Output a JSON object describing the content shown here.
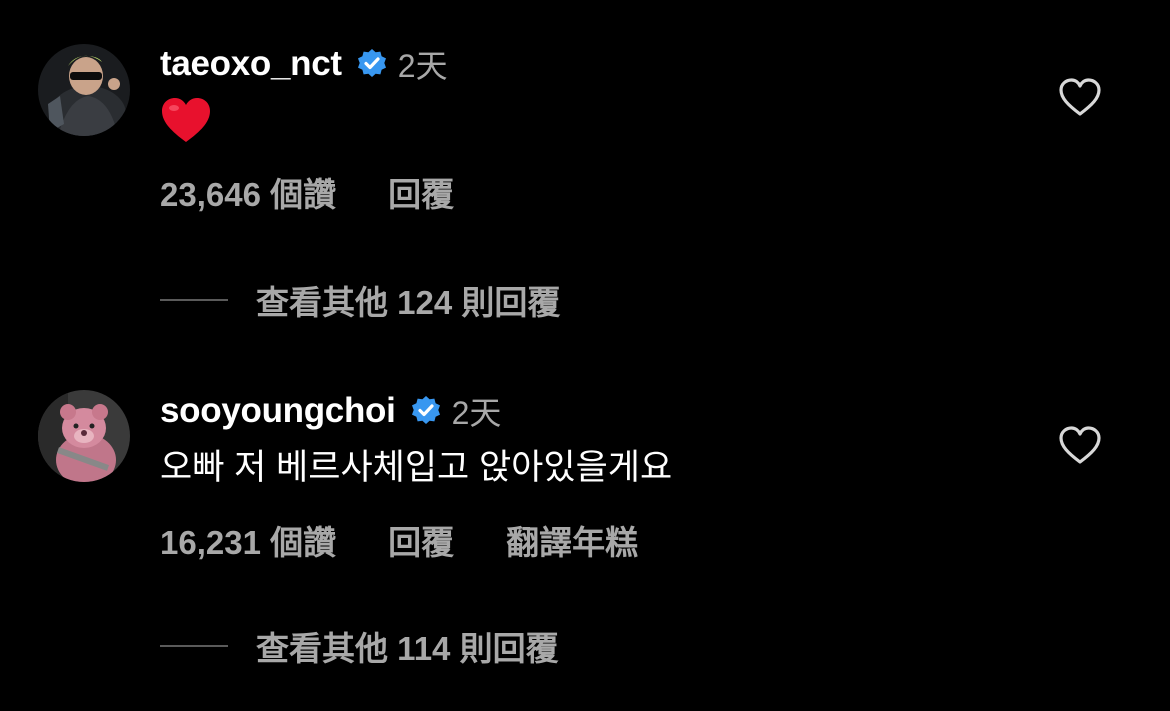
{
  "comments": [
    {
      "username": "taeoxo_nct",
      "verified": true,
      "time": "2天",
      "body": "❤️",
      "likes": "23,646 個讚",
      "reply_label": "回覆",
      "view_replies": "查看其他 124 則回覆",
      "avatar_icon": "profile-photo"
    },
    {
      "username": "sooyoungchoi",
      "verified": true,
      "time": "2天",
      "body": "오빠 저 베르사체입고 앉아있을게요",
      "likes": "16,231 個讚",
      "reply_label": "回覆",
      "translate_label": "翻譯年糕",
      "view_replies": "查看其他 114 則回覆",
      "avatar_icon": "profile-photo"
    }
  ],
  "colors": {
    "background": "#000000",
    "text_primary": "#ffffff",
    "text_secondary": "#a8a8a8",
    "verified_blue": "#3897f0",
    "heart_red": "#e0245e"
  }
}
